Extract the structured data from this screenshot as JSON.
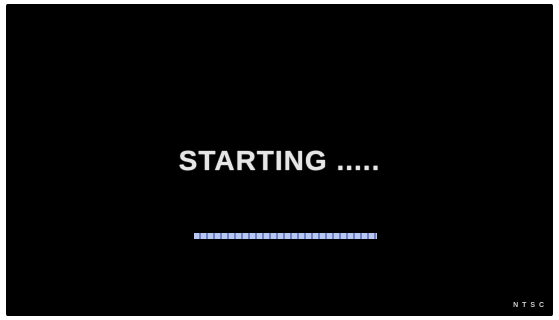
{
  "screen": {
    "status_text": "STARTING .....",
    "background_color": "#000000",
    "text_color": "#e6e6e6"
  },
  "progress": {
    "fraction": 1.0,
    "fill_color": "#b9c6f0",
    "segment_color": "#6e82c8"
  },
  "corner": {
    "label": "N T S C"
  }
}
